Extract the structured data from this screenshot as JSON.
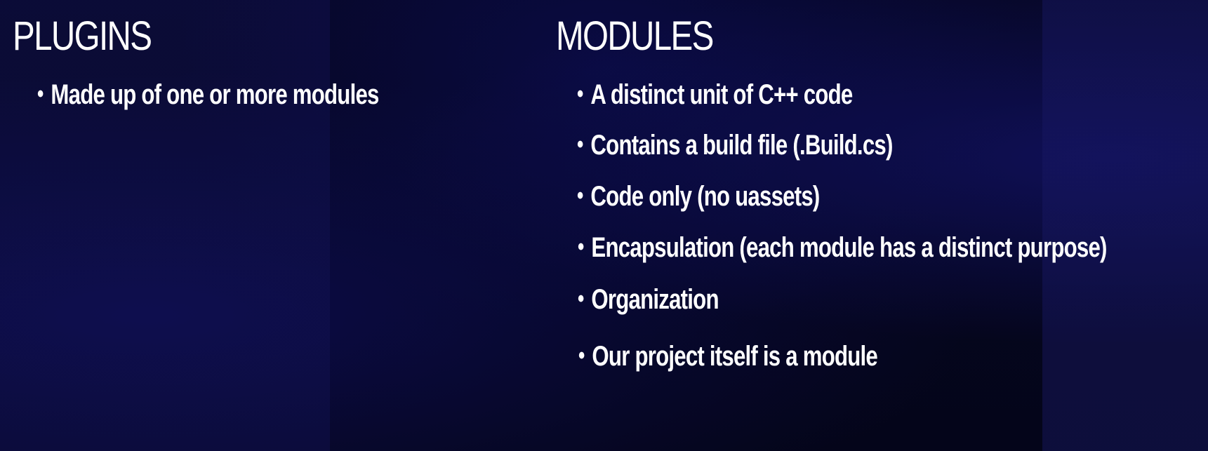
{
  "plugins": {
    "title": "PLUGINS",
    "items": [
      "Made up of one or more modules"
    ]
  },
  "modules": {
    "title": "MODULES",
    "items": [
      "A distinct unit of C++ code",
      "Contains a build file (.Build.cs)",
      "Code only (no uassets)",
      "Encapsulation (each module has a distinct purpose)",
      "Organization",
      "Our project itself is a module"
    ]
  },
  "bullet_glyph": "•",
  "colors": {
    "background": "#05061e",
    "text": "#ffffff"
  }
}
